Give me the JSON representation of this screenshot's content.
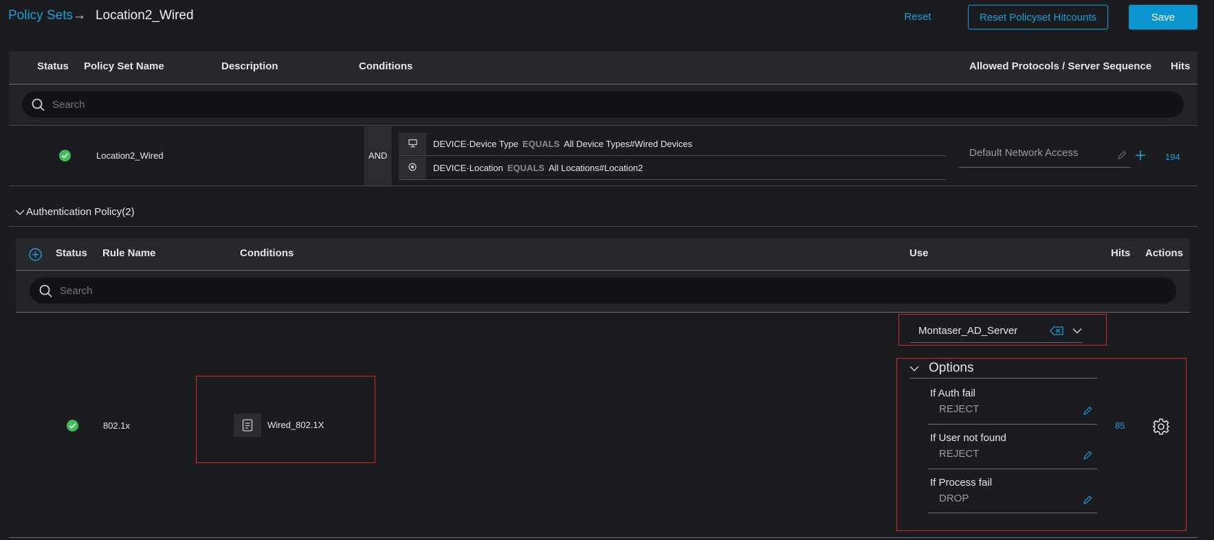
{
  "header": {
    "breadcrumb_root": "Policy Sets",
    "arrow": "→",
    "current": "Location2_Wired",
    "reset_label": "Reset",
    "reset_hitcounts_label": "Reset Policyset Hitcounts",
    "save_label": "Save"
  },
  "policy_table": {
    "columns": [
      "Status",
      "Policy Set Name",
      "Description",
      "Conditions",
      "Allowed Protocols / Server Sequence",
      "Hits"
    ],
    "search_placeholder": "Search",
    "row": {
      "name": "Location2_Wired",
      "operator": "AND",
      "conditions": [
        {
          "attr": "DEVICE·Device Type",
          "op": "EQUALS",
          "value": "All Device Types#Wired Devices"
        },
        {
          "attr": "DEVICE·Location",
          "op": "EQUALS",
          "value": "All Locations#Location2"
        }
      ],
      "allowed_protocol": "Default Network Access",
      "hits": "194"
    }
  },
  "auth_policy": {
    "section_title": "Authentication Policy(2)",
    "columns": [
      "Status",
      "Rule Name",
      "Conditions",
      "Use",
      "Hits",
      "Actions"
    ],
    "search_placeholder": "Search",
    "rule": {
      "name": "802.1x",
      "condition": "Wired_802.1X",
      "use_value": "Montaser_AD_Server",
      "options_title": "Options",
      "options": [
        {
          "label": "If Auth fail",
          "value": "REJECT"
        },
        {
          "label": "If User not found",
          "value": "REJECT"
        },
        {
          "label": "If Process fail",
          "value": "DROP"
        }
      ],
      "hits": "85"
    }
  },
  "colors": {
    "accent": "#1ba0d8",
    "status_ok": "#3fbf5c",
    "highlight": "#d9262c",
    "background": "#1b1c1f"
  },
  "icons": [
    "search-icon",
    "check-circle-icon",
    "monitor-icon",
    "location-icon",
    "pencil-icon",
    "plus-icon",
    "chevron-down-icon",
    "add-circle-icon",
    "document-icon",
    "clear-icon",
    "gear-icon"
  ]
}
